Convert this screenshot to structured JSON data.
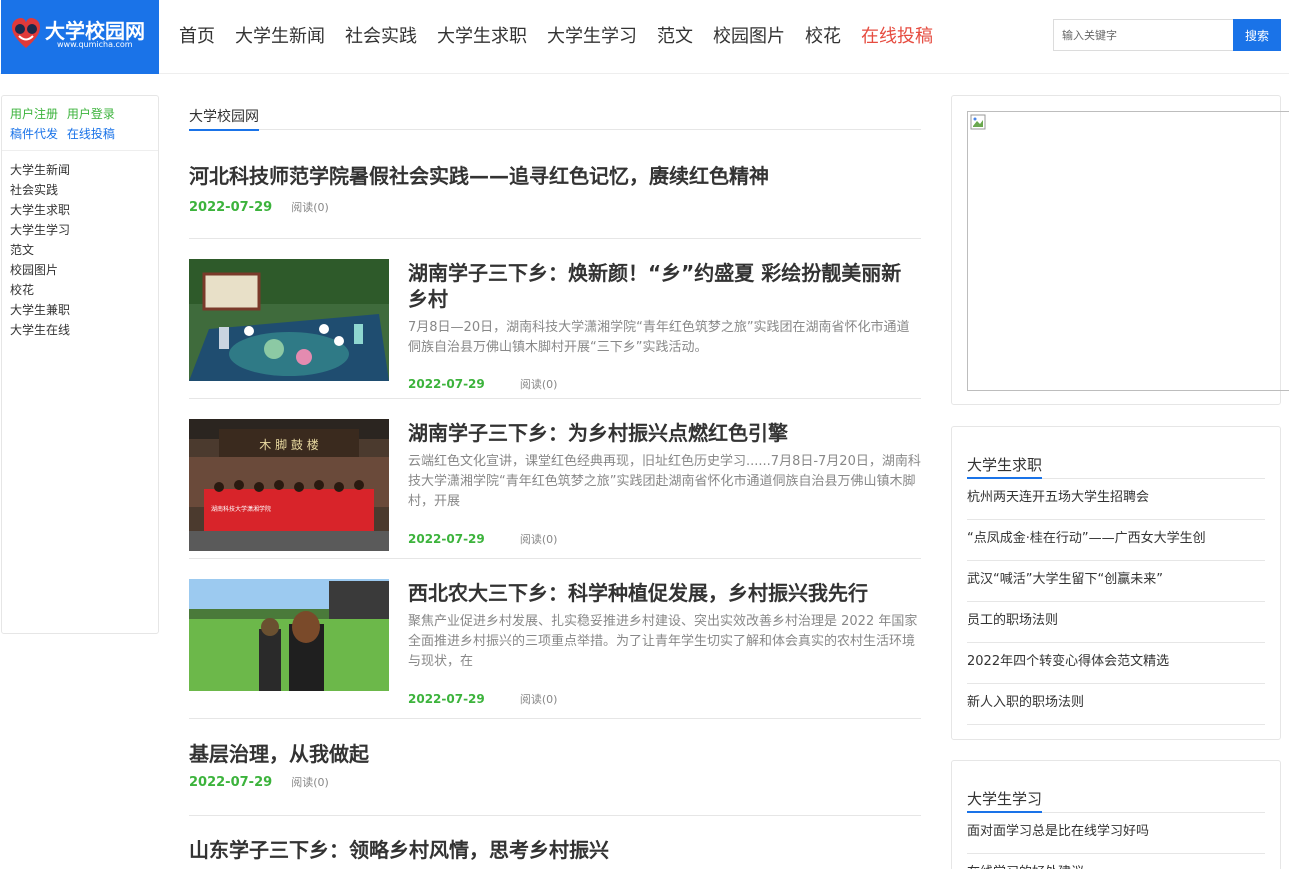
{
  "site": {
    "logo_title": "大学校园网",
    "logo_url_text": "www.qumicha.com"
  },
  "nav": [
    {
      "label": "首页"
    },
    {
      "label": "大学生新闻"
    },
    {
      "label": "社会实践"
    },
    {
      "label": "大学生求职"
    },
    {
      "label": "大学生学习"
    },
    {
      "label": "范文"
    },
    {
      "label": "校园图片"
    },
    {
      "label": "校花"
    },
    {
      "label": "在线投稿",
      "highlight": true
    }
  ],
  "search": {
    "placeholder": "输入关键字",
    "button_label": "搜索"
  },
  "sidebar": {
    "account_links": {
      "register": "用户注册",
      "login": "用户登录",
      "proxy_post": "稿件代发",
      "submit": "在线投稿"
    },
    "categories": [
      "大学生新闻",
      "社会实践",
      "大学生求职",
      "大学生学习",
      "范文",
      "校园图片",
      "校花",
      "大学生兼职",
      "大学生在线"
    ]
  },
  "main": {
    "section_title": "大学校园网",
    "articles": [
      {
        "title": "河北科技师范学院暑假社会实践——追寻红色记忆，赓续红色精神",
        "date": "2022-07-29",
        "reads": "阅读(0)"
      },
      {
        "title": "湖南学子三下乡：焕新颜！“乡”约盛夏 彩绘扮靓美丽新乡村",
        "desc": "7月8日—20日，湖南科技大学潇湘学院“青年红色筑梦之旅”实践团在湖南省怀化市通道侗族自治县万佛山镇木脚村开展“三下乡”实践活动。",
        "date": "2022-07-29",
        "reads": "阅读(0)"
      },
      {
        "title": "湖南学子三下乡：为乡村振兴点燃红色引擎",
        "desc": "云端红色文化宣讲，课堂红色经典再现，旧址红色历史学习......7月8日-7月20日，湖南科技大学潇湘学院“青年红色筑梦之旅”实践团赴湖南省怀化市通道侗族自治县万佛山镇木脚村，开展",
        "date": "2022-07-29",
        "reads": "阅读(0)",
        "sign_text": "木 脚 鼓 楼",
        "banner_text": "湖南科技大学潇湘学院"
      },
      {
        "title": "西北农大三下乡：科学种植促发展，乡村振兴我先行",
        "desc": "聚焦产业促进乡村发展、扎实稳妥推进乡村建设、突出实效改善乡村治理是 2022 年国家全面推进乡村振兴的三项重点举措。为了让青年学生切实了解和体会真实的农村生活环境与现状，在",
        "date": "2022-07-29",
        "reads": "阅读(0)"
      },
      {
        "title": "基层治理，从我做起",
        "date": "2022-07-29",
        "reads": "阅读(0)"
      },
      {
        "title": "山东学子三下乡：领略乡村风情，思考乡村振兴"
      }
    ]
  },
  "right": {
    "jobs": {
      "title": "大学生求职",
      "items": [
        "杭州两天连开五场大学生招聘会",
        "“点凤成金·桂在行动”——广西女大学生创",
        "武汉“喊活”大学生留下“创赢未来”",
        "员工的职场法则",
        "2022年四个转变心得体会范文精选",
        "新人入职的职场法则"
      ]
    },
    "study": {
      "title": "大学生学习",
      "items": [
        "面对面学习总是比在线学习好吗",
        "在线学习的好处建议"
      ]
    }
  },
  "colors": {
    "brand_blue": "#1a73e8",
    "date_green": "#3cb33c",
    "highlight_red": "#e64c40"
  }
}
